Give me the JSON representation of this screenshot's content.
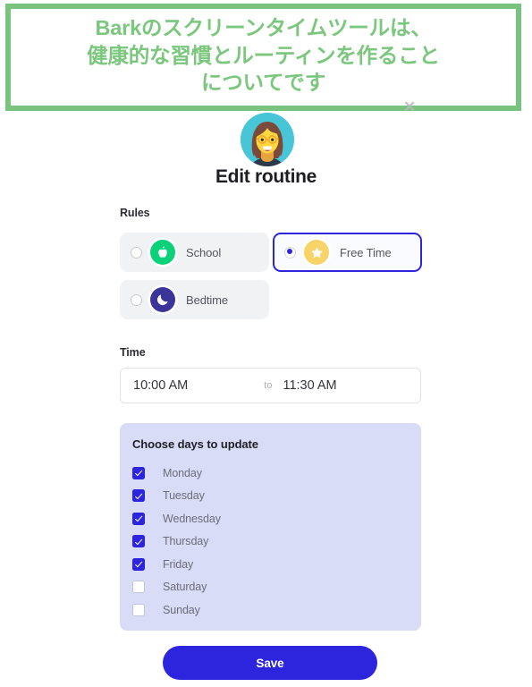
{
  "banner": {
    "text": "Barkのスクリーンタイムツールは、\n健康的な習慣とルーティンを作ること\nについてです",
    "border_color": "#79c47c",
    "text_color": "#7ac77d",
    "watermark": "✕"
  },
  "header": {
    "avatar_icon": "woman-with-glasses-avatar",
    "title": "Edit routine"
  },
  "rules": {
    "label": "Rules",
    "options": [
      {
        "label": "School",
        "icon": "apple-icon",
        "icon_color": "#0bd27a",
        "selected": false
      },
      {
        "label": "Free Time",
        "icon": "star-icon",
        "icon_color": "#f8d468",
        "selected": true
      },
      {
        "label": "Bedtime",
        "icon": "moon-icon",
        "icon_color": "#3b3499",
        "selected": false
      }
    ],
    "selected_color": "#2d25dd"
  },
  "time": {
    "label": "Time",
    "start": "10:00 AM",
    "separator": "to",
    "end": "11:30 AM"
  },
  "days": {
    "title": "Choose days to update",
    "panel_color": "#d9dcf7",
    "items": [
      {
        "label": "Monday",
        "checked": true
      },
      {
        "label": "Tuesday",
        "checked": true
      },
      {
        "label": "Wednesday",
        "checked": true
      },
      {
        "label": "Thursday",
        "checked": true
      },
      {
        "label": "Friday",
        "checked": true
      },
      {
        "label": "Saturday",
        "checked": false
      },
      {
        "label": "Sunday",
        "checked": false
      }
    ]
  },
  "footer": {
    "save_label": "Save",
    "save_color": "#2d25dd"
  }
}
